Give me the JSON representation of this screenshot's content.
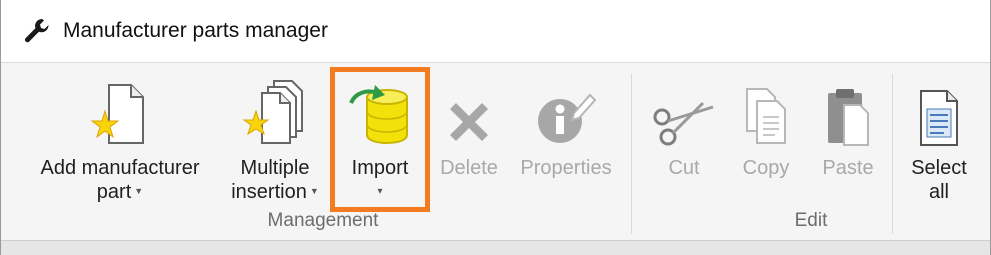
{
  "window": {
    "title": "Manufacturer parts manager",
    "title_icon": "wrench-icon"
  },
  "ribbon": {
    "groups": {
      "management_label": "Management",
      "edit_label": "Edit"
    },
    "buttons": {
      "add_manufacturer_part": {
        "line1": "Add manufacturer",
        "line2": "part",
        "icon": "new-part-icon",
        "has_dropdown": true
      },
      "multiple_insertion": {
        "line1": "Multiple",
        "line2": "insertion",
        "icon": "multiple-documents-icon",
        "has_dropdown": true
      },
      "import": {
        "label": "Import",
        "icon": "database-import-icon",
        "has_dropdown": true,
        "highlighted": true
      },
      "delete": {
        "label": "Delete",
        "icon": "delete-x-icon",
        "enabled": false
      },
      "properties": {
        "label": "Properties",
        "icon": "properties-info-icon",
        "enabled": false
      },
      "cut": {
        "label": "Cut",
        "icon": "scissors-icon",
        "enabled": false
      },
      "copy": {
        "label": "Copy",
        "icon": "copy-icon",
        "enabled": false
      },
      "paste": {
        "label": "Paste",
        "icon": "paste-clipboard-icon",
        "enabled": false
      },
      "select_all": {
        "line1": "Select",
        "line2": "all",
        "icon": "select-all-icon",
        "enabled": true
      }
    }
  },
  "colors": {
    "highlight_border": "#f47c20",
    "disabled_text": "#a9a9a9",
    "group_label": "#6d6d6d",
    "star_yellow": "#f8d40a",
    "database_yellow": "#f2e20a",
    "arrow_green": "#2e9a43"
  }
}
